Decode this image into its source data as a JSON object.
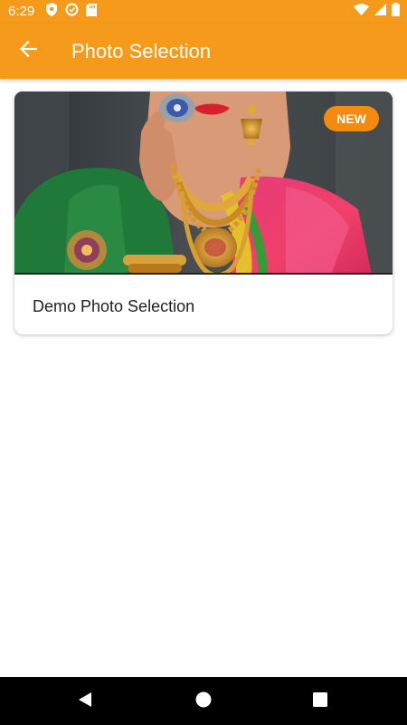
{
  "status_bar": {
    "time": "6:29"
  },
  "app_bar": {
    "title": "Photo Selection",
    "back_icon": "arrow-left-icon"
  },
  "cards": [
    {
      "title": "Demo Photo Selection",
      "badge": "NEW",
      "image": "bride-jewelry-photo"
    }
  ],
  "nav_bar": {
    "back_icon": "triangle-back-icon",
    "home_icon": "circle-home-icon",
    "recents_icon": "square-recents-icon"
  },
  "colors": {
    "accent": "#F59A1A",
    "badge": "#F58A10",
    "nav_background": "#000000"
  }
}
